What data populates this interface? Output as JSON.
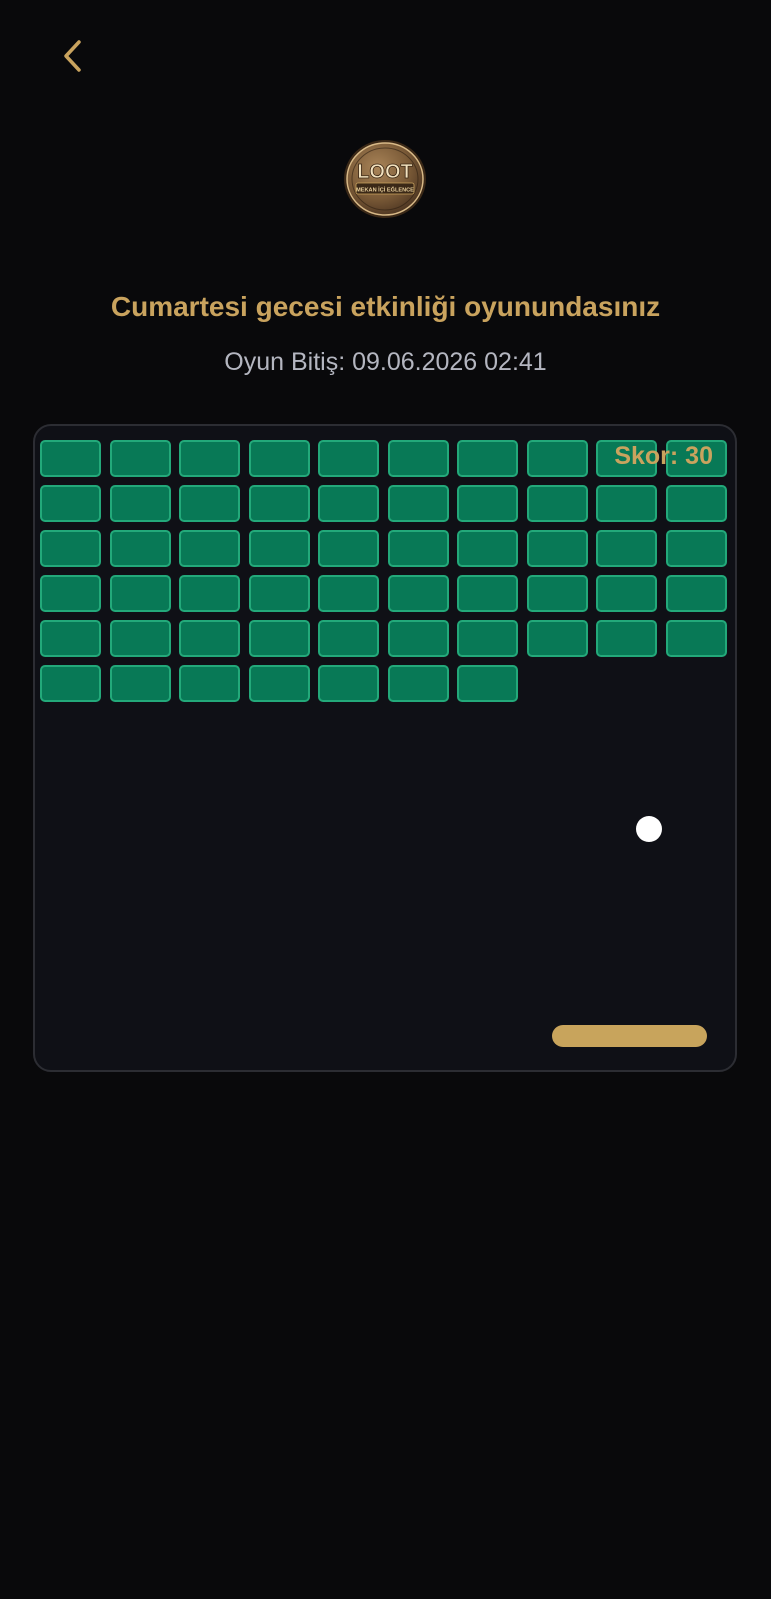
{
  "header": {
    "back_icon": "chevron-left-icon",
    "logo": {
      "brand_text": "LOOT",
      "tagline": "MEKAN İÇİ EĞLENCE"
    }
  },
  "event": {
    "title": "Cumartesi gecesi etkinliği oyunundasınız",
    "end_time": "Oyun Bitiş: 09.06.2026 02:41"
  },
  "game": {
    "score_text": "Skor: 30",
    "brick_rows": [
      [
        1,
        1,
        1,
        1,
        1,
        1,
        1,
        1,
        1,
        1
      ],
      [
        1,
        1,
        1,
        1,
        1,
        1,
        1,
        1,
        1,
        1
      ],
      [
        1,
        1,
        1,
        1,
        1,
        1,
        1,
        1,
        1,
        1
      ],
      [
        1,
        1,
        1,
        1,
        1,
        1,
        1,
        1,
        1,
        1
      ],
      [
        1,
        1,
        1,
        1,
        1,
        1,
        1,
        1,
        1,
        1
      ],
      [
        1,
        1,
        1,
        1,
        1,
        1,
        1,
        0,
        0,
        0
      ]
    ]
  },
  "colors": {
    "accent_gold": "#c9a35e",
    "background": "#09090b",
    "board_background": "#0f1016",
    "brick_fill": "#087956",
    "brick_border": "#23a97a",
    "ball": "#ffffff",
    "paddle": "#c8a45c",
    "subtitle_gray": "#b4b6c0"
  }
}
